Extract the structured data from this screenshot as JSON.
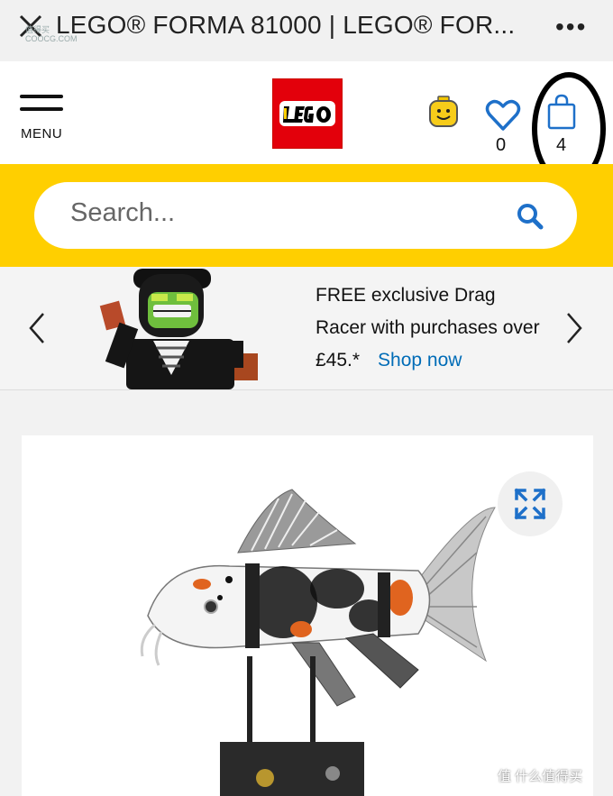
{
  "titlebar": {
    "title": "LEGO® FORMA 81000 | LEGO® FOR...",
    "more": "•••",
    "watermark_top": "值得买\nCOOCG.COM"
  },
  "header": {
    "menu_label": "MENU",
    "wishlist_count": "0",
    "bag_count": "4"
  },
  "search": {
    "placeholder": "Search..."
  },
  "banner": {
    "promo_text": "FREE exclusive Drag Racer with purchases over £45.*",
    "shop_link": "Shop now"
  },
  "watermark": "值 什么值得买",
  "colors": {
    "brand_yellow": "#ffcf00",
    "brand_red": "#e3000b",
    "link_blue": "#006cb7"
  }
}
